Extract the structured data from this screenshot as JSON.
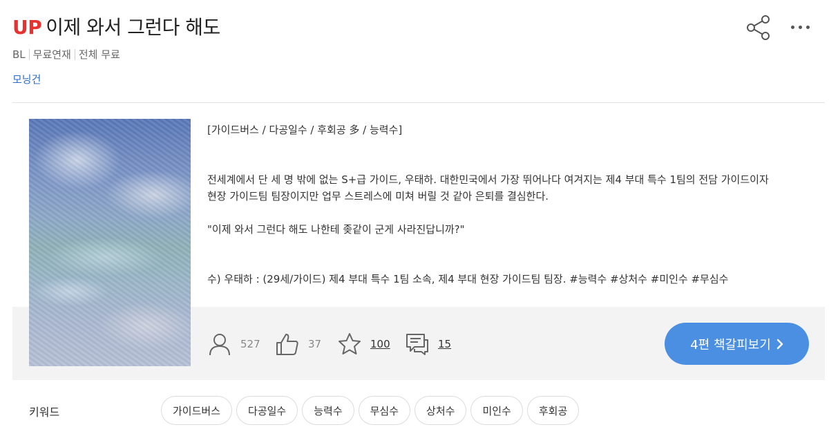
{
  "header": {
    "badge": "UP",
    "title": "이제 와서 그런다 해도",
    "meta": [
      "BL",
      "무료연재",
      "전체 무료"
    ],
    "author": "모닝건",
    "share_icon": "share-icon",
    "more_icon": "more-icon"
  },
  "description": {
    "tags_line": "[가이드버스 / 다공일수 / 후회공 多 / 능력수]",
    "paragraph_1": "전세계에서 단 세 명 밖에 없는 S+급 가이드, 우태하. 대한민국에서 가장 뛰어나다 여겨지는 제4 부대 특수 1팀의 전담 가이드이자",
    "paragraph_2": "현장 가이드팀 팀장이지만 업무 스트레스에 미쳐 버릴 것 같아 은퇴를 결심한다.",
    "quote": "\"이제 와서 그런다 해도 나한테 좆같이 군게 사라진답니까?\"",
    "character": "수) 우태하 : (29세/가이드) 제4 부대 특수 1팀 소속, 제4 부대 현장 가이드팀 팀장. #능력수 #상처수 #미인수 #무심수"
  },
  "stats": {
    "views": "527",
    "likes": "37",
    "bookmarks": "100",
    "comments": "15"
  },
  "read_button": {
    "label": "4편 책갈피보기"
  },
  "keywords": {
    "label": "키워드",
    "items": [
      "가이드버스",
      "다공일수",
      "능력수",
      "무심수",
      "상처수",
      "미인수",
      "후회공"
    ]
  },
  "colors": {
    "accent": "#4a8fe1",
    "up_badge": "#e8322f",
    "author_link": "#2d6bc9"
  }
}
